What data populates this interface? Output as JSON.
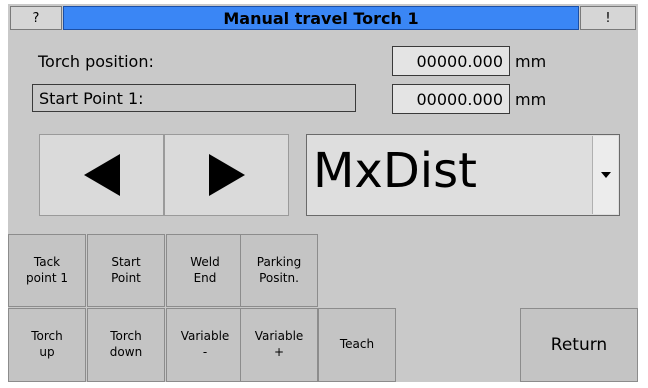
{
  "title_bar": {
    "help": "?",
    "title": "Manual travel Torch 1",
    "alert": "!"
  },
  "torch_position": {
    "label": "Torch position:",
    "value": "00000.000",
    "unit": "mm"
  },
  "start_point": {
    "label": "Start Point 1:",
    "value": "00000.000",
    "unit": "mm"
  },
  "jog": {
    "left_icon": "left-arrow-icon",
    "right_icon": "right-arrow-icon"
  },
  "mode_select": {
    "value": "MxDist",
    "arrow_icon": "chevron-down-icon"
  },
  "softkeys_row1": [
    {
      "line1": "Tack",
      "line2": "point 1"
    },
    {
      "line1": "Start",
      "line2": "Point"
    },
    {
      "line1": "Weld",
      "line2": "End"
    },
    {
      "line1": "Parking",
      "line2": "Positn."
    }
  ],
  "softkeys_row2": [
    {
      "line1": "Torch",
      "line2": "up"
    },
    {
      "line1": "Torch",
      "line2": "down"
    },
    {
      "line1": "Variable",
      "line2": "-"
    },
    {
      "line1": "Variable",
      "line2": "+"
    },
    {
      "line1": "Teach",
      "line2": ""
    }
  ],
  "return_label": "Return"
}
